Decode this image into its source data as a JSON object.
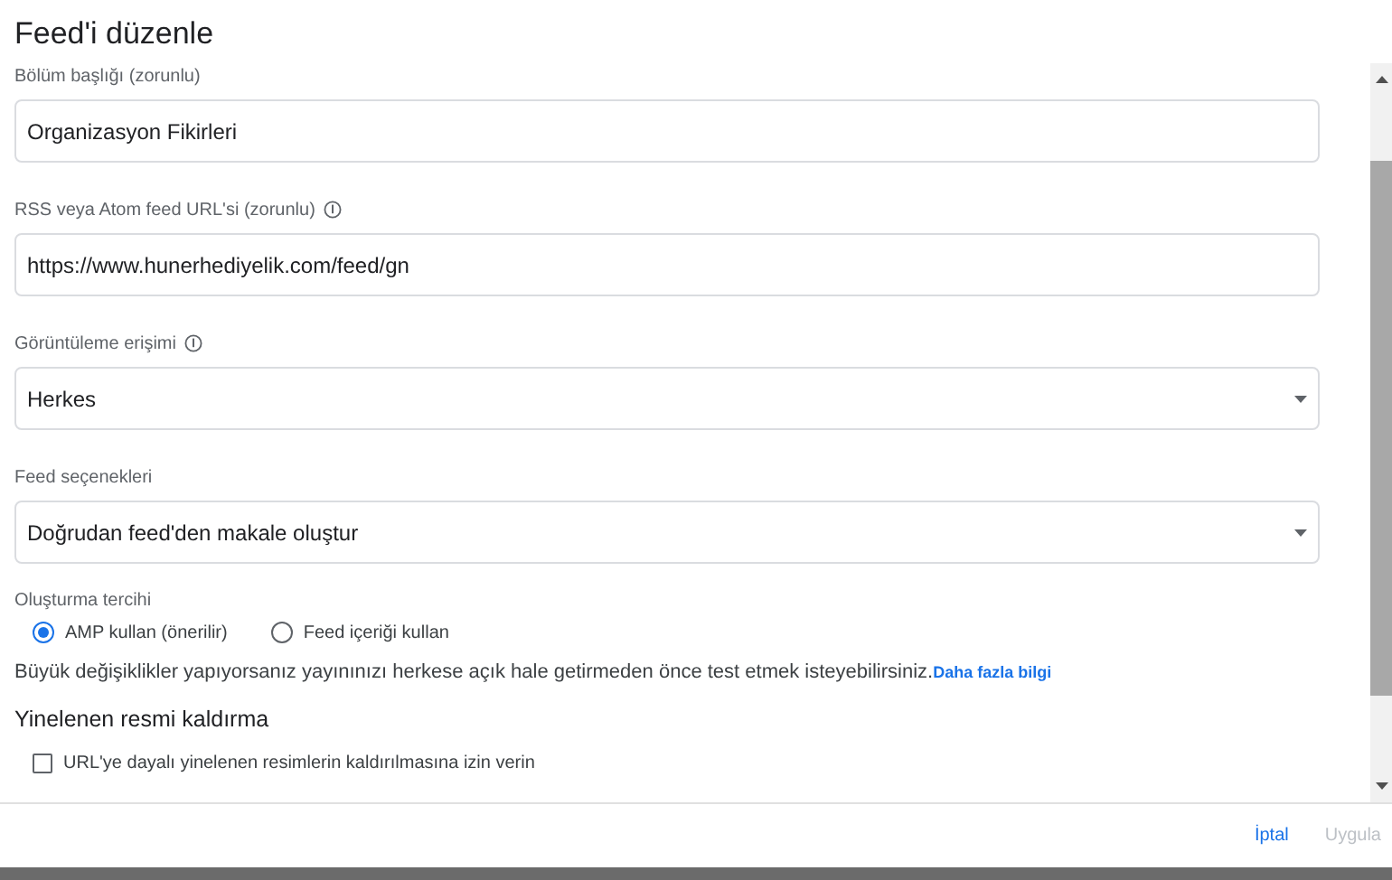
{
  "dialog": {
    "title": "Feed'i düzenle"
  },
  "fields": [
    {
      "label": "Bölüm başlığı (zorunlu)",
      "info": false,
      "kind": "text",
      "value": "Organizasyon Fikirleri"
    },
    {
      "label": "RSS veya Atom feed URL'si (zorunlu)",
      "info": true,
      "kind": "text",
      "value": "https://www.hunerhediyelik.com/feed/gn"
    },
    {
      "label": "Görüntüleme erişimi",
      "info": true,
      "kind": "select",
      "value": "Herkes"
    },
    {
      "label": "Feed seçenekleri",
      "info": false,
      "kind": "select",
      "value": "Doğrudan feed'den makale oluştur"
    }
  ],
  "creation_preference": {
    "label": "Oluşturma tercihi",
    "options": [
      {
        "label": "AMP kullan (önerilir)",
        "selected": true
      },
      {
        "label": "Feed içeriği kullan",
        "selected": false
      }
    ]
  },
  "notice": {
    "text": "Büyük değişiklikler yapıyorsanız yayınınızı herkese açık hale getirmeden önce test etmek isteyebilirsiniz.",
    "link": "Daha fazla bilgi"
  },
  "duplicate_images": {
    "heading": "Yinelenen resmi kaldırma",
    "options": [
      {
        "label": "URL'ye dayalı yinelenen resimlerin kaldırılmasına izin verin",
        "checked": false
      }
    ]
  },
  "buttons": [
    {
      "label": "İptal",
      "disabled": false
    },
    {
      "label": "Uygula",
      "disabled": true
    }
  ]
}
